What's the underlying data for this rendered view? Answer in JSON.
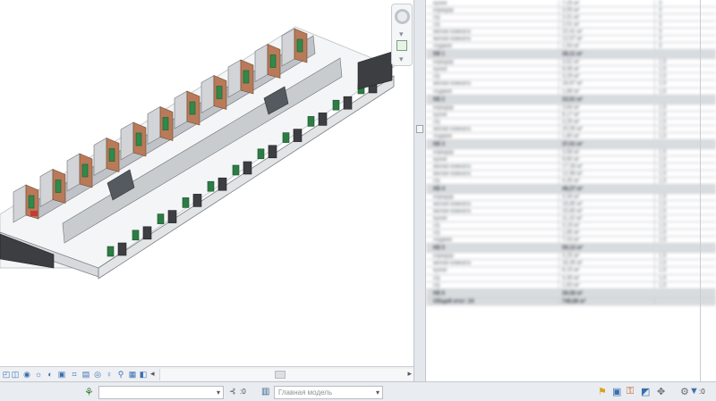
{
  "view": {
    "name": "3d-model-view"
  },
  "view_statusbar": {
    "icons": [
      "scale-icon",
      "detail-level-icon",
      "visual-style-icon",
      "sun-path-icon",
      "shadows-icon",
      "render-icon",
      "crop-icon",
      "crop-visible-icon",
      "temporary-hide-icon",
      "reveal-hidden-icon",
      "lock-view-icon",
      "analysis-icon",
      "highlight-icon"
    ]
  },
  "schedule": {
    "rows": [
      {
        "kind": "row",
        "c1": "кухня",
        "c2": "7,25 м²",
        "c3": "3"
      },
      {
        "kind": "row",
        "c1": "коридор",
        "c2": "3,05 м²",
        "c3": "3"
      },
      {
        "kind": "row",
        "c1": "с/у",
        "c2": "2,01 м²",
        "c3": "3"
      },
      {
        "kind": "row",
        "c1": "с/у",
        "c2": "2,01 м²",
        "c3": "3"
      },
      {
        "kind": "row",
        "c1": "жилая комната",
        "c2": "10,41 м²",
        "c3": "3"
      },
      {
        "kind": "row",
        "c1": "жилая комната",
        "c2": "12,57 м²",
        "c3": "3"
      },
      {
        "kind": "row",
        "c1": "лоджия",
        "c2": "1,54 м²",
        "c3": "3"
      },
      {
        "kind": "group",
        "c1": "КВ 1",
        "c2": "38,11 м²",
        "c3": ""
      },
      {
        "kind": "row",
        "c1": "коридор",
        "c2": "3,52 м²",
        "c3": "1,5"
      },
      {
        "kind": "row",
        "c1": "кухня",
        "c2": "8,06 м²",
        "c3": "1,5"
      },
      {
        "kind": "row",
        "c1": "с/у",
        "c2": "3,29 м²",
        "c3": "1,5"
      },
      {
        "kind": "row",
        "c1": "жилая комната",
        "c2": "16,67 м²",
        "c3": "1,5"
      },
      {
        "kind": "row",
        "c1": "лоджия",
        "c2": "1,88 м²",
        "c3": "1,5"
      },
      {
        "kind": "group",
        "c1": "КВ 2",
        "c2": "33,51 м²",
        "c3": ""
      },
      {
        "kind": "row",
        "c1": "коридор",
        "c2": "3,64 м²",
        "c3": "1,5"
      },
      {
        "kind": "row",
        "c1": "кухня",
        "c2": "8,17 м²",
        "c3": "1,5"
      },
      {
        "kind": "row",
        "c1": "с/у",
        "c2": "3,25 м²",
        "c3": "1,5"
      },
      {
        "kind": "row",
        "c1": "жилая комната",
        "c2": "20,05 м²",
        "c3": "1,5"
      },
      {
        "kind": "row",
        "c1": "лоджия",
        "c2": "1,80 м²",
        "c3": "1,5"
      },
      {
        "kind": "group",
        "c1": "КВ 3",
        "c2": "37,01 м²",
        "c3": ""
      },
      {
        "kind": "row",
        "c1": "коридор",
        "c2": "3,58 м²",
        "c3": "1,5"
      },
      {
        "kind": "row",
        "c1": "кухня",
        "c2": "9,60 м²",
        "c3": "1,5"
      },
      {
        "kind": "row",
        "c1": "жилая комната",
        "c2": "17,28 м²",
        "c3": "1,5"
      },
      {
        "kind": "row",
        "c1": "жилая комната",
        "c2": "12,96 м²",
        "c3": "1,5"
      },
      {
        "kind": "row",
        "c1": "с/у",
        "c2": "4,35 м²",
        "c3": "1,5"
      },
      {
        "kind": "group",
        "c1": "КВ 4",
        "c2": "48,27 м²",
        "c3": ""
      },
      {
        "kind": "row",
        "c1": "коридор",
        "c2": "3,34 м²",
        "c3": "1,5"
      },
      {
        "kind": "row",
        "c1": "жилая комната",
        "c2": "16,85 м²",
        "c3": "1,5"
      },
      {
        "kind": "row",
        "c1": "жилая комната",
        "c2": "15,60 м²",
        "c3": "1,5"
      },
      {
        "kind": "row",
        "c1": "кухня",
        "c2": "11,32 м²",
        "c3": "1,5"
      },
      {
        "kind": "row",
        "c1": "с/у",
        "c2": "3,19 м²",
        "c3": "1,5"
      },
      {
        "kind": "row",
        "c1": "с/у",
        "c2": "1,85 м²",
        "c3": "1,5"
      },
      {
        "kind": "row",
        "c1": "лоджия",
        "c2": "7,03 м²",
        "c3": "1,5"
      },
      {
        "kind": "group",
        "c1": "КВ 5",
        "c2": "59,12 м²",
        "c3": ""
      },
      {
        "kind": "row",
        "c1": "коридор",
        "c2": "3,25 м²",
        "c3": "1,5"
      },
      {
        "kind": "row",
        "c1": "жилая комната",
        "c2": "16,35 м²",
        "c3": "1,5"
      },
      {
        "kind": "row",
        "c1": "кухня",
        "c2": "8,15 м²",
        "c3": "1,5"
      },
      {
        "kind": "row",
        "c1": "с/у",
        "c2": "3,35 м²",
        "c3": "1,5"
      },
      {
        "kind": "row",
        "c1": "с/у",
        "c2": "1,63 м²",
        "c3": "1,5"
      },
      {
        "kind": "group",
        "c1": "КВ 6",
        "c2": "28,58 м²",
        "c3": ""
      },
      {
        "kind": "total",
        "c1": "Общий итог: 24",
        "c2": "748,88 м²",
        "c3": ""
      }
    ]
  },
  "statusbar": {
    "workset_value": "",
    "filter_count": ":0",
    "model_placeholder": "Главная модель",
    "selection_filter_count": ":0"
  }
}
